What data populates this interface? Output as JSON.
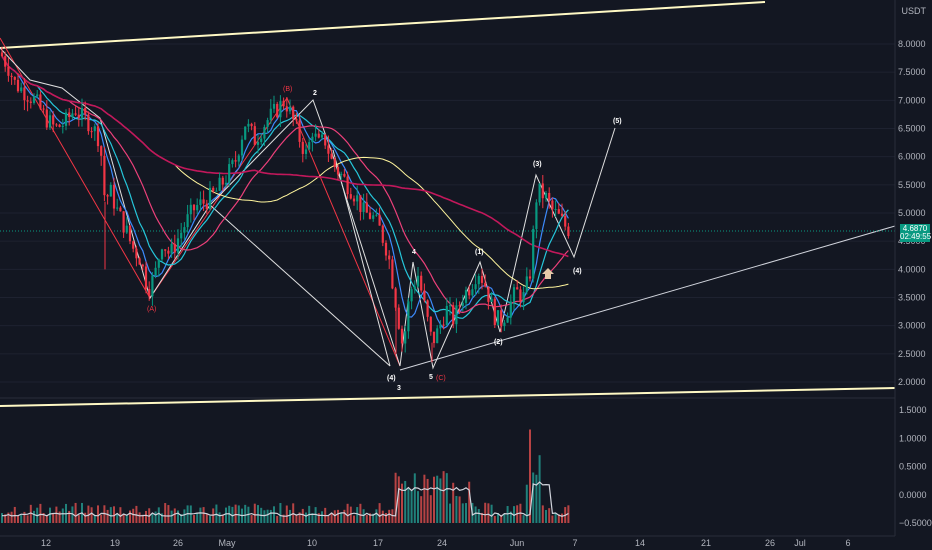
{
  "currency": "USDT",
  "last_price": "4.6870",
  "countdown": "02:49:55",
  "colors": {
    "background": "#131722",
    "up": "#089981",
    "down": "#f23645",
    "volume_up": "#26a69a",
    "volume_down": "#ef5350",
    "ma_fast": "#3d8bfd",
    "ma_mid": "#26c6da",
    "ma_slow": "#ec407a",
    "ma_long": "#c2185b",
    "ma_yellow": "#fff59d",
    "channel": "#fff9c4",
    "wave_line": "#e0e0e0"
  },
  "chart_data": {
    "type": "candlestick",
    "price_axis_ticks": [
      "8.0000",
      "7.5000",
      "7.0000",
      "6.5000",
      "6.0000",
      "5.5000",
      "5.0000",
      "4.5000",
      "4.0000",
      "3.5000",
      "3.0000",
      "2.5000",
      "2.0000"
    ],
    "oscillator_axis_ticks": [
      "1.5000",
      "1.0000",
      "0.5000",
      "0.0000",
      "−0.5000"
    ],
    "time_axis_ticks": [
      "12",
      "19",
      "26",
      "May",
      "10",
      "17",
      "24",
      "Jun",
      "7",
      "14",
      "21",
      "26",
      "Jul",
      "6"
    ],
    "price_ylim": [
      2.0,
      8.0
    ],
    "price_points": [
      [
        0,
        7.85
      ],
      [
        8,
        7.6
      ],
      [
        15,
        7.3
      ],
      [
        25,
        7.15
      ],
      [
        35,
        7.0
      ],
      [
        45,
        6.7
      ],
      [
        55,
        6.5
      ],
      [
        65,
        6.6
      ],
      [
        75,
        6.85
      ],
      [
        82,
        6.7
      ],
      [
        90,
        6.6
      ],
      [
        100,
        6.3
      ],
      [
        105,
        5.2
      ],
      [
        110,
        5.4
      ],
      [
        118,
        5.0
      ],
      [
        125,
        4.75
      ],
      [
        132,
        4.4
      ],
      [
        140,
        4.2
      ],
      [
        148,
        3.65
      ],
      [
        155,
        3.9
      ],
      [
        162,
        4.5
      ],
      [
        170,
        4.25
      ],
      [
        178,
        4.55
      ],
      [
        185,
        4.8
      ],
      [
        195,
        5.1
      ],
      [
        205,
        5.2
      ],
      [
        215,
        5.35
      ],
      [
        225,
        5.6
      ],
      [
        235,
        5.9
      ],
      [
        245,
        6.6
      ],
      [
        255,
        6.3
      ],
      [
        265,
        6.6
      ],
      [
        275,
        6.8
      ],
      [
        285,
        7.0
      ],
      [
        292,
        6.7
      ],
      [
        300,
        6.3
      ],
      [
        307,
        6.0
      ],
      [
        312,
        6.5
      ],
      [
        318,
        6.2
      ],
      [
        325,
        6.3
      ],
      [
        332,
        5.9
      ],
      [
        340,
        5.7
      ],
      [
        348,
        5.5
      ],
      [
        356,
        5.3
      ],
      [
        364,
        5.0
      ],
      [
        372,
        4.95
      ],
      [
        380,
        4.7
      ],
      [
        388,
        4.3
      ],
      [
        396,
        3.4
      ],
      [
        403,
        2.6
      ],
      [
        410,
        3.6
      ],
      [
        418,
        3.9
      ],
      [
        425,
        3.3
      ],
      [
        432,
        2.7
      ],
      [
        438,
        2.9
      ],
      [
        446,
        3.3
      ],
      [
        454,
        3.1
      ],
      [
        462,
        3.5
      ],
      [
        470,
        3.7
      ],
      [
        478,
        4.0
      ],
      [
        486,
        3.7
      ],
      [
        494,
        3.2
      ],
      [
        500,
        3.05
      ],
      [
        508,
        3.3
      ],
      [
        516,
        3.6
      ],
      [
        524,
        3.5
      ],
      [
        530,
        3.95
      ],
      [
        537,
        5.4
      ],
      [
        545,
        5.3
      ],
      [
        552,
        5.05
      ],
      [
        560,
        4.9
      ],
      [
        566,
        4.75
      ],
      [
        570,
        4.69
      ]
    ],
    "moving_average_count": 5,
    "wave_labels": {
      "A": "(A)",
      "B": "(B)",
      "C": "(C)",
      "w2": "2",
      "w3": "3",
      "w4": "4",
      "w5": "5",
      "p1": "(1)",
      "p2": "(2)",
      "p3": "(3)",
      "p4": "(4)",
      "p5": "(5)",
      "p4_early": "(4)"
    }
  }
}
